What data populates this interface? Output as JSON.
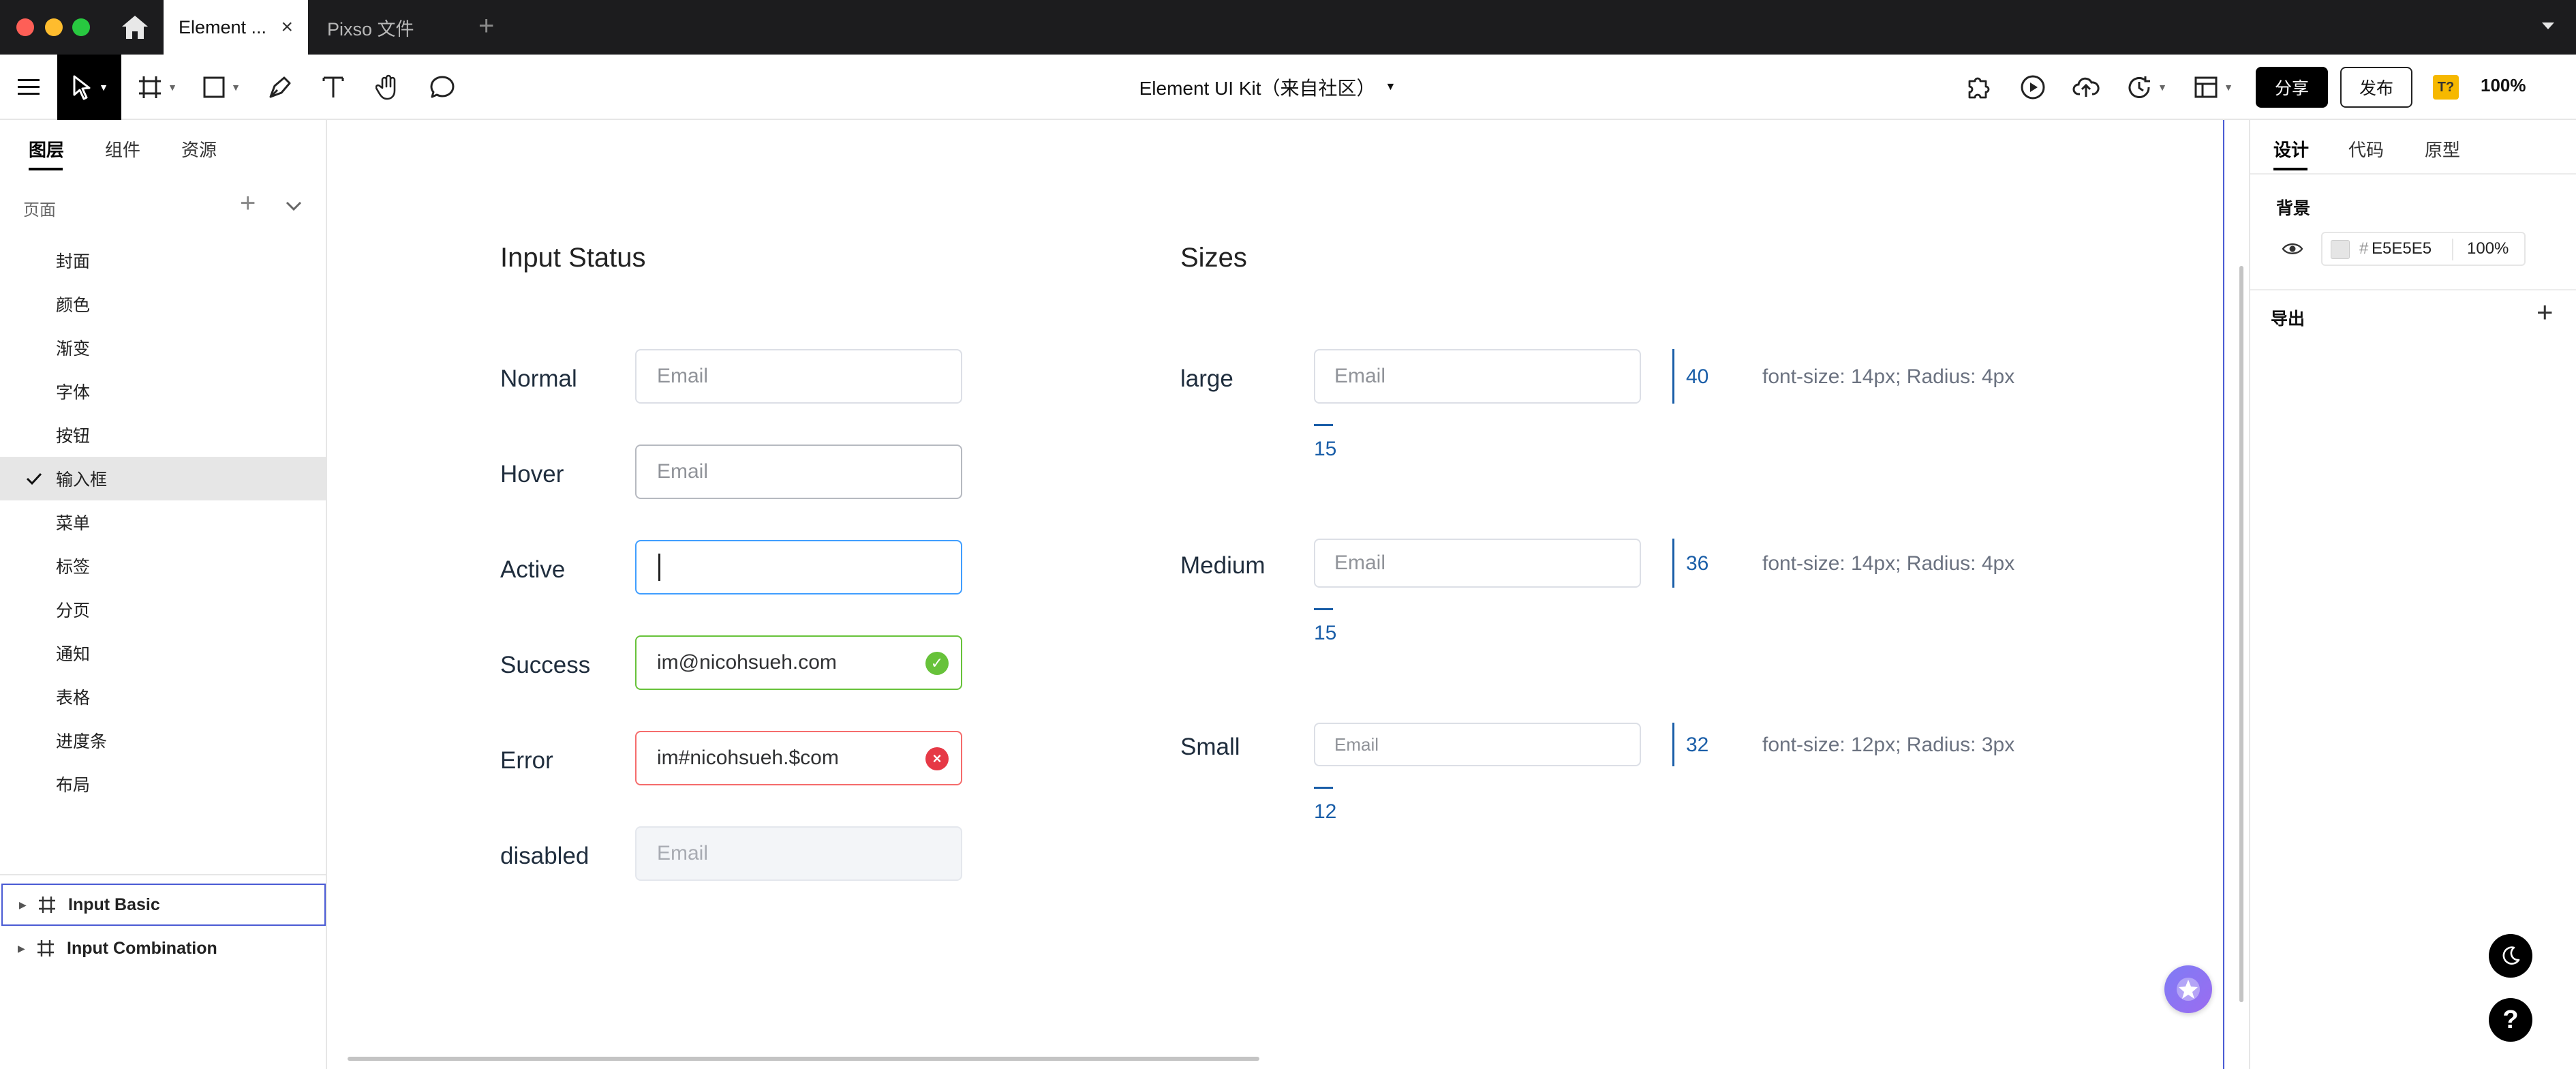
{
  "window": {
    "tabs": [
      {
        "label": "Element ..."
      },
      {
        "label": "Pixso 文件"
      }
    ]
  },
  "toolbar": {
    "doc_title": "Element UI Kit（来自社区）",
    "share_label": "分享",
    "publish_label": "发布",
    "font_badge": "T?",
    "zoom": "100%"
  },
  "left_panel": {
    "tabs": [
      "图层",
      "组件",
      "资源"
    ],
    "pages_header": "页面",
    "pages": [
      "封面",
      "颜色",
      "渐变",
      "字体",
      "按钮",
      "输入框",
      "菜单",
      "标签",
      "分页",
      "通知",
      "表格",
      "进度条",
      "布局"
    ],
    "selected_page": "输入框",
    "layers": [
      "Input Basic",
      "Input Combination"
    ]
  },
  "canvas": {
    "status_section": {
      "title": "Input Status",
      "rows": [
        {
          "label": "Normal",
          "value": "Email"
        },
        {
          "label": "Hover",
          "value": "Email"
        },
        {
          "label": "Active",
          "value": ""
        },
        {
          "label": "Success",
          "value": "im@nicohsueh.com"
        },
        {
          "label": "Error",
          "value": "im#nicohsueh.$com"
        },
        {
          "label": "disabled",
          "value": "Email"
        }
      ]
    },
    "sizes_section": {
      "title": "Sizes",
      "rows": [
        {
          "label": "large",
          "placeholder": "Email",
          "height": "40",
          "padding": "15",
          "desc": "font-size: 14px; Radius: 4px"
        },
        {
          "label": "Medium",
          "placeholder": "Email",
          "height": "36",
          "padding": "15",
          "desc": "font-size: 14px; Radius: 4px"
        },
        {
          "label": "Small",
          "placeholder": "Email",
          "height": "32",
          "padding": "12",
          "desc": "font-size: 12px; Radius: 3px"
        }
      ]
    }
  },
  "right_panel": {
    "tabs": [
      "设计",
      "代码",
      "原型"
    ],
    "background_label": "背景",
    "hex_prefix": "#",
    "hex": "E5E5E5",
    "opacity": "100",
    "opacity_unit": "%",
    "export_label": "导出"
  },
  "colors": {
    "accent_blue": "#409eff",
    "success": "#67c23a",
    "error": "#f56c6c",
    "dimension": "#1a5ea8"
  }
}
